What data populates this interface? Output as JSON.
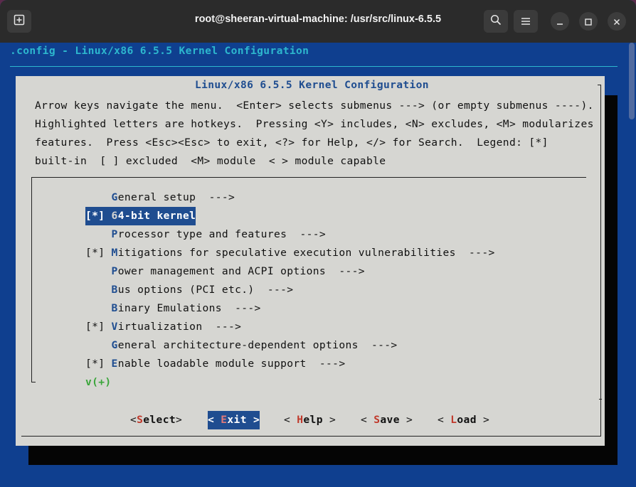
{
  "window": {
    "title": "root@sheeran-virtual-machine: /usr/src/linux-6.5.5",
    "buttons": [
      "new-tab-icon",
      "search-icon",
      "hamburger-menu-icon",
      "minimize-icon",
      "maximize-icon",
      "close-icon"
    ]
  },
  "terminal": {
    "header": ".config - Linux/x86 6.5.5 Kernel Configuration",
    "dialog_title": "Linux/x86 6.5.5 Kernel Configuration",
    "help_lines": [
      "Arrow keys navigate the menu.  <Enter> selects submenus ---> (or empty submenus ----).",
      "Highlighted letters are hotkeys.  Pressing <Y> includes, <N> excludes, <M> modularizes",
      "features.  Press <Esc><Esc> to exit, <?> for Help, </> for Search.  Legend: [*]",
      "built-in  [ ] excluded  <M> module  < > module capable"
    ],
    "menu_items": [
      {
        "prefix": "    ",
        "hotkey": "G",
        "rest": "eneral setup  --->"
      },
      {
        "prefix": "[*] ",
        "hotkey": "6",
        "rest": "4-bit kernel"
      },
      {
        "prefix": "    ",
        "hotkey": "P",
        "rest": "rocessor type and features  --->"
      },
      {
        "prefix": "[*] ",
        "hotkey": "M",
        "rest": "itigations for speculative execution vulnerabilities  --->"
      },
      {
        "prefix": "    ",
        "hotkey": "P",
        "rest": "ower management and ACPI options  --->"
      },
      {
        "prefix": "    ",
        "hotkey": "B",
        "rest": "us options (PCI etc.)  --->"
      },
      {
        "prefix": "    ",
        "hotkey": "B",
        "rest": "inary Emulations  --->"
      },
      {
        "prefix": "[*] ",
        "hotkey": "V",
        "rest": "irtualization  --->"
      },
      {
        "prefix": "    ",
        "hotkey": "G",
        "rest": "eneral architecture-dependent options  --->"
      },
      {
        "prefix": "[*] ",
        "hotkey": "E",
        "rest": "nable loadable module support  --->"
      }
    ],
    "selected_item": "[*] 64-bit kernel",
    "more_indicator": "v(+)",
    "buttons": {
      "select": {
        "open": "<",
        "key": "S",
        "rest": "elect",
        "close": ">"
      },
      "exit": {
        "open": "< ",
        "key": "E",
        "rest": "xit",
        "close": " >"
      },
      "help": {
        "open": "< ",
        "key": "H",
        "rest": "elp",
        "close": " >"
      },
      "save": {
        "open": "< ",
        "key": "S",
        "rest": "ave",
        "close": " >"
      },
      "load": {
        "open": "< ",
        "key": "L",
        "rest": "oad",
        "close": " >"
      }
    }
  }
}
